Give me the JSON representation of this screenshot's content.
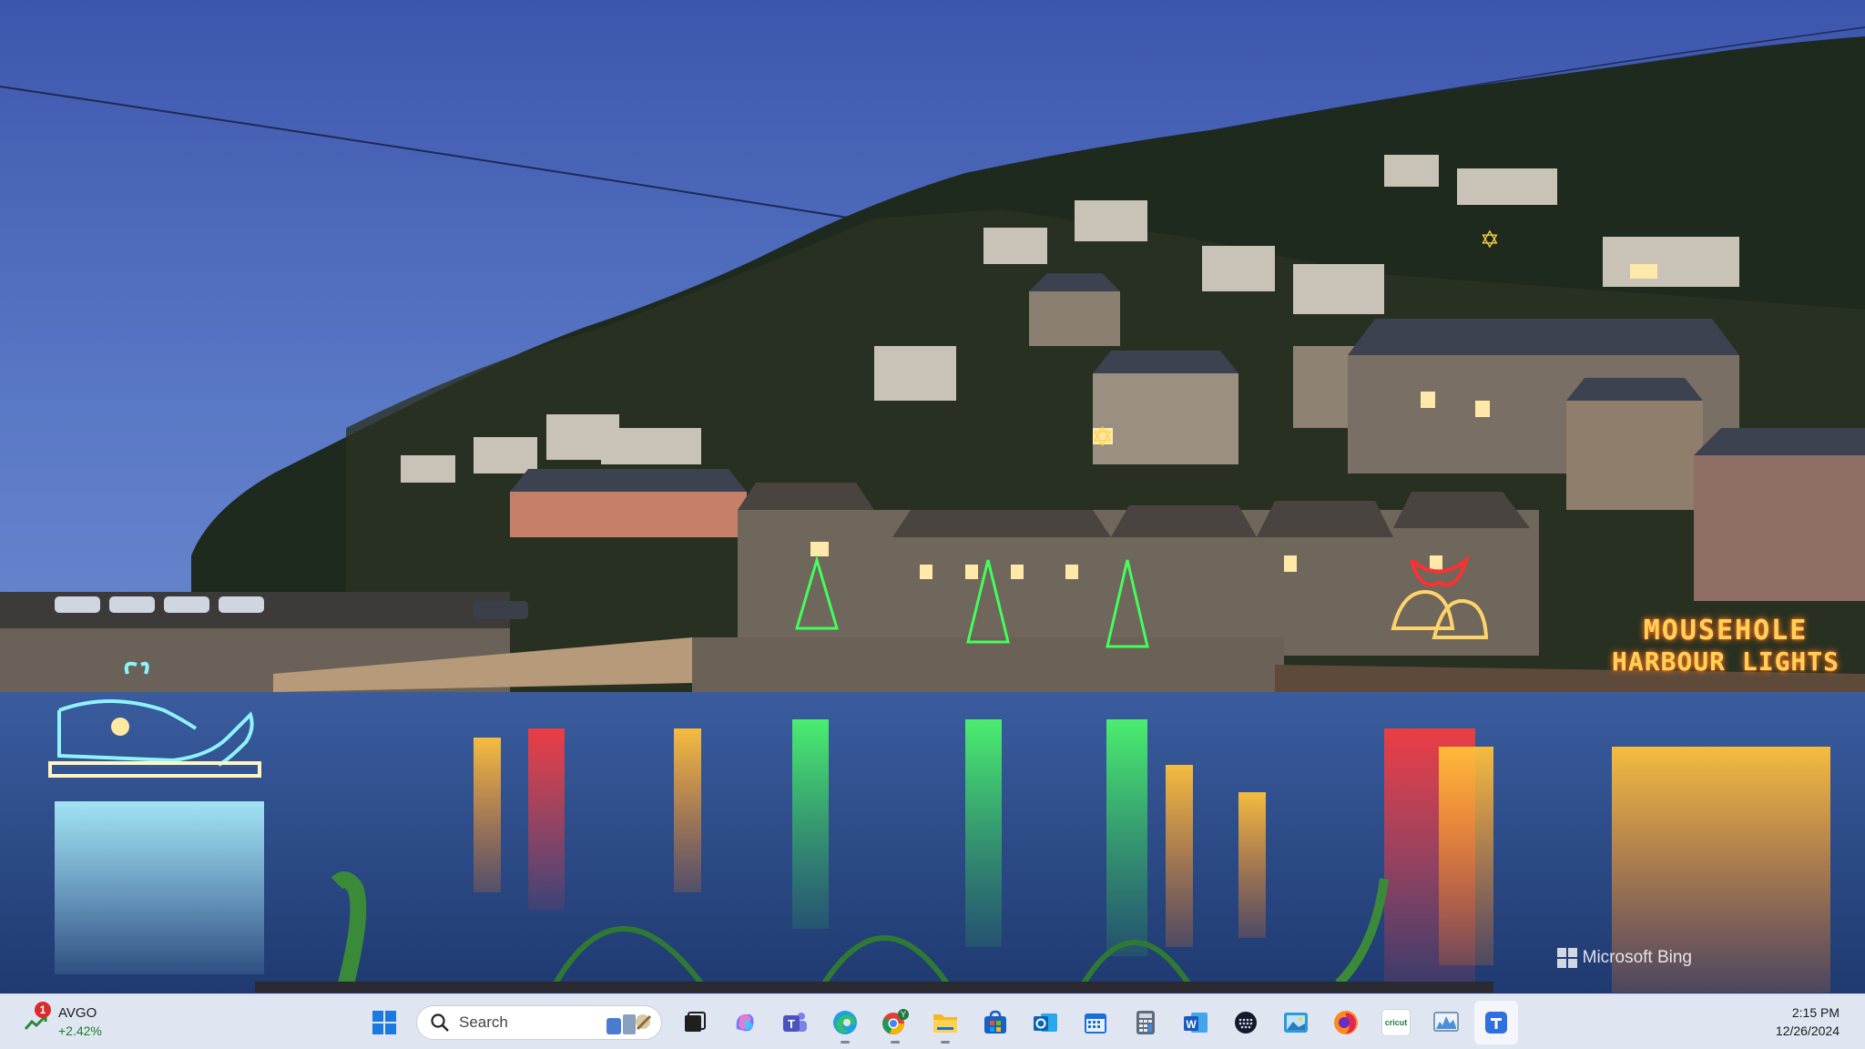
{
  "wallpaper": {
    "scene_description_label": "Mousehole harbour at dusk",
    "sign_line_1": "MOUSEHOLE",
    "sign_line_2": "HARBOUR LIGHTS",
    "watermark": "Microsoft Bing"
  },
  "taskbar": {
    "widget": {
      "ticker": "AVGO",
      "change": "+2.42%",
      "badge_count": "1",
      "icon": "trend-up-icon"
    },
    "search": {
      "placeholder": "Search"
    },
    "apps": [
      {
        "name": "start-button",
        "icon": "windows-logo-icon"
      },
      {
        "name": "task-view-button",
        "icon": "task-view-icon"
      },
      {
        "name": "copilot-button",
        "icon": "copilot-icon"
      },
      {
        "name": "teams-button",
        "icon": "teams-icon"
      },
      {
        "name": "edge-button",
        "icon": "edge-icon"
      },
      {
        "name": "chrome-button",
        "icon": "chrome-icon"
      },
      {
        "name": "file-explorer-button",
        "icon": "folder-icon"
      },
      {
        "name": "store-button",
        "icon": "store-icon"
      },
      {
        "name": "outlook-button",
        "icon": "outlook-icon"
      },
      {
        "name": "calendar-button",
        "icon": "calendar-icon"
      },
      {
        "name": "calculator-button",
        "icon": "calculator-icon"
      },
      {
        "name": "word-button",
        "icon": "word-icon"
      },
      {
        "name": "dots-app-button",
        "icon": "dots-icon"
      },
      {
        "name": "photos-button",
        "icon": "photos-icon"
      },
      {
        "name": "firefox-button",
        "icon": "firefox-icon"
      },
      {
        "name": "cricut-button",
        "icon": "cricut-icon"
      },
      {
        "name": "monitor-button",
        "icon": "chart-app-icon"
      },
      {
        "name": "active-app-button",
        "icon": "shield-app-icon"
      }
    ],
    "cricut_label": "cricut",
    "chrome_badge": "Y",
    "clock": {
      "time": "2:15 PM",
      "date": "12/26/2024"
    }
  },
  "colors": {
    "sky_top": "#3b57b0",
    "sky_bottom": "#5f7fc9",
    "water": "#2b4a86",
    "taskbar": "#dfe6f2",
    "win_blue": "#1a6ed8"
  }
}
